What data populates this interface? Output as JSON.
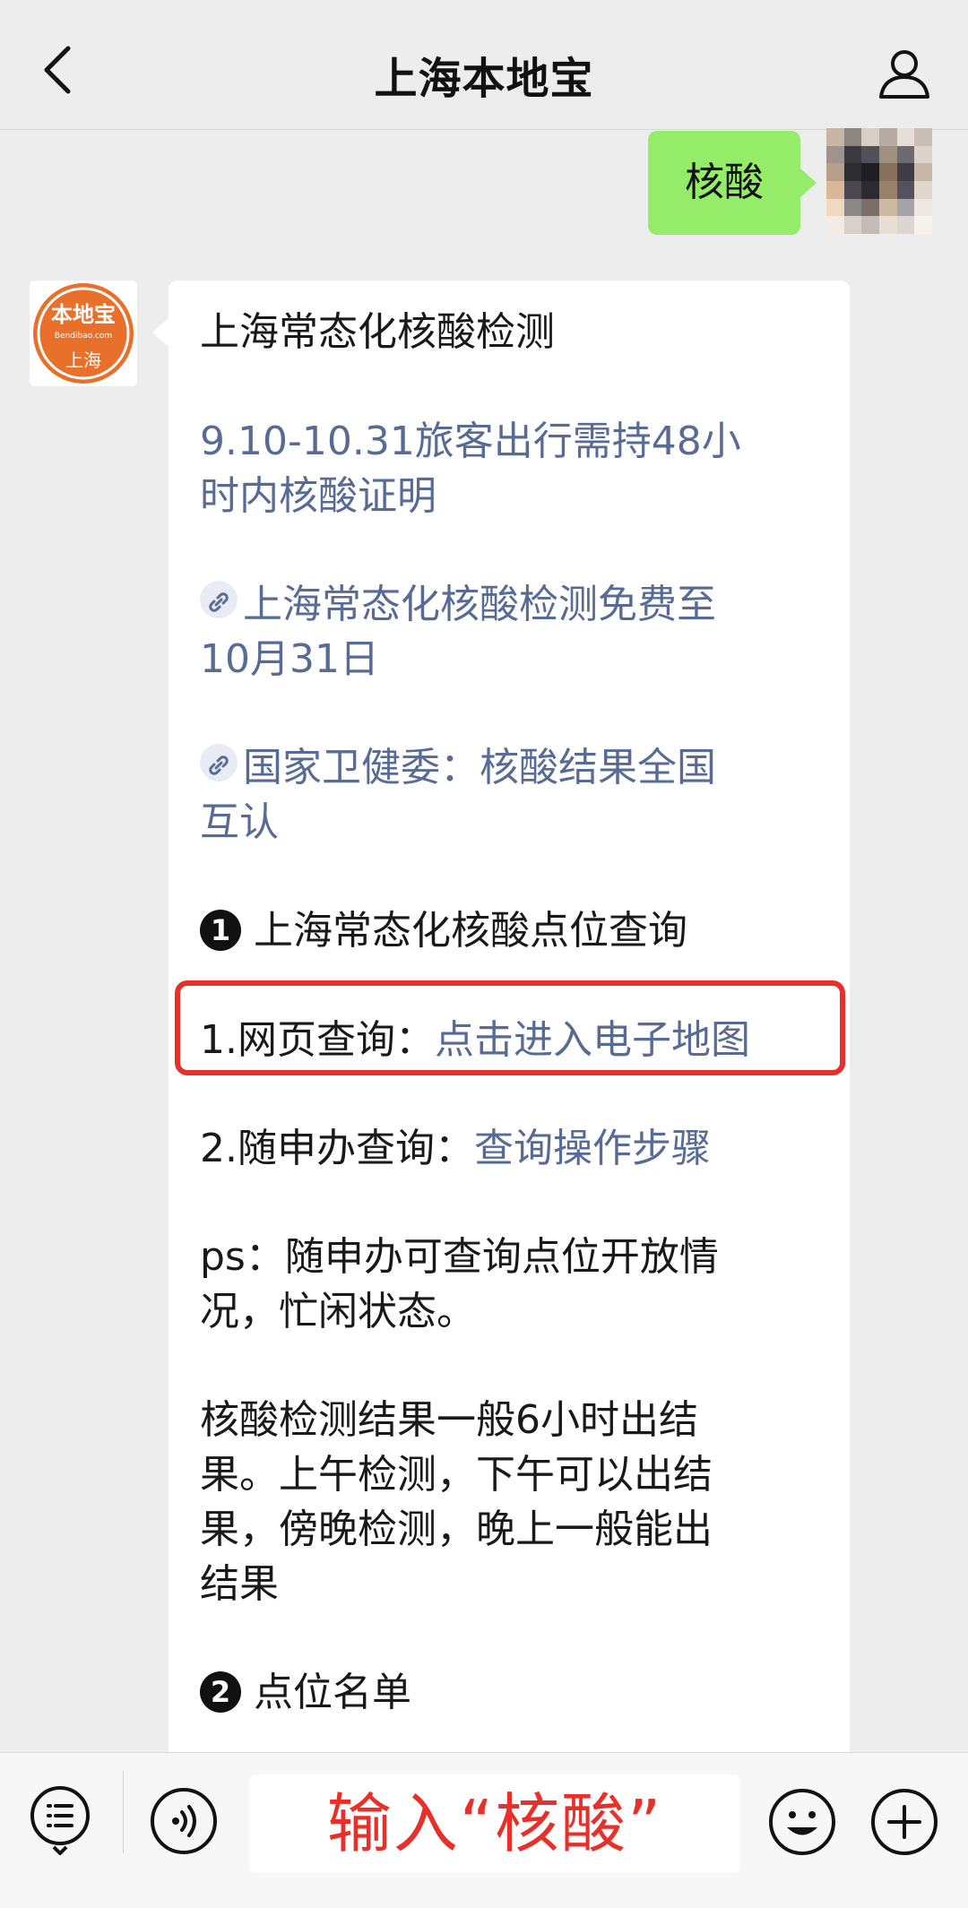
{
  "header": {
    "title": "上海本地宝"
  },
  "user_message": {
    "text": "核酸"
  },
  "bot_avatar": {
    "brand": "本地宝",
    "domain": "Bendibao.com",
    "city": "上海"
  },
  "bot_message": {
    "heading": "上海常态化核酸检测",
    "link1_line1": "9.10-10.31旅客出行需持48小",
    "link1_line2": "时内核酸证明",
    "link2_line1": "上海常态化核酸检测免费至",
    "link2_line2": "10月31日",
    "link3_line1": "国家卫健委：核酸结果全国",
    "link3_line2": "互认",
    "section1_number": "1",
    "section1_title": "上海常态化核酸点位查询",
    "web_query_label": "1.网页查询：",
    "web_query_link": "点击进入电子地图",
    "app_query_label": "2.随申办查询：",
    "app_query_link": "查询操作步骤",
    "ps_line1": "ps：随申办可查询点位开放情",
    "ps_line2": "况，忙闲状态。",
    "result_line1": "核酸检测结果一般6小时出结",
    "result_line2": "果。上午检测，下午可以出结",
    "result_line3": "果，傍晚检测，晚上一般能出",
    "result_line4": "结果",
    "section2_number": "2",
    "section2_title": "点位名单"
  },
  "input": {
    "overlay_text": "输入“核酸”"
  },
  "colors": {
    "link": "#576b95",
    "bubble_green": "#95ec69",
    "highlight_red": "#e8302a",
    "avatar_orange": "#e8702a"
  },
  "icons": [
    "back-arrow-icon",
    "profile-icon",
    "link-chain-icon",
    "menu-list-icon",
    "voice-icon",
    "emoji-icon",
    "plus-icon"
  ]
}
